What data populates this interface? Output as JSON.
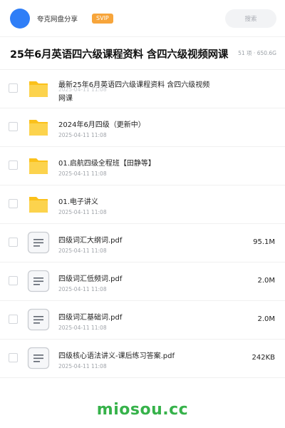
{
  "header": {
    "user_name": "夸克网盘分享",
    "vip_label": "SVIP",
    "search_placeholder": "搜索"
  },
  "share": {
    "title": "25年6月英语四六级课程资料 含四六级视频网课",
    "meta": "51 项 · 650.6G"
  },
  "files": [
    {
      "type": "folder",
      "name": "最新25年6月英语四六级课程资料 含四六级视频网课",
      "date": "2025-04-11 11:08",
      "size": ""
    },
    {
      "type": "folder",
      "name": "2024年6月四级（更新中）",
      "date": "2025-04-11 11:08",
      "size": ""
    },
    {
      "type": "folder",
      "name": "01.启航四级全程班【田静等】",
      "date": "2025-04-11 11:08",
      "size": ""
    },
    {
      "type": "folder",
      "name": "01.电子讲义",
      "date": "2025-04-11 11:08",
      "size": ""
    },
    {
      "type": "file",
      "name": "四级词汇大纲词.pdf",
      "date": "2025-04-11 11:08",
      "size": "95.1M"
    },
    {
      "type": "file",
      "name": "四级词汇低频词.pdf",
      "date": "2025-04-11 11:08",
      "size": "2.0M"
    },
    {
      "type": "file",
      "name": "四级词汇基础词.pdf",
      "date": "2025-04-11 11:08",
      "size": "2.0M"
    },
    {
      "type": "file",
      "name": "四级核心语法讲义-课后练习答案.pdf",
      "date": "2025-04-11 11:08",
      "size": "242KB"
    }
  ],
  "icons": {
    "folder": "folder-icon",
    "file": "document-icon"
  },
  "colors": {
    "avatar": "#2f7ef7",
    "vip": "#f7a53b",
    "folder": "#fbc11b",
    "watermark": "#36b24a"
  },
  "watermark": "miosou.cc"
}
